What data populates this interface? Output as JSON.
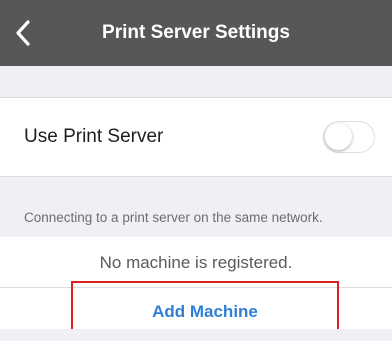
{
  "navbar": {
    "title": "Print Server Settings",
    "back_icon": "chevron-left-icon"
  },
  "settings": {
    "use_print_server": {
      "label": "Use Print Server",
      "enabled": false
    },
    "footnote": "Connecting to a print server on the same network."
  },
  "machines": {
    "empty_message": "No machine is registered.",
    "add_label": "Add Machine"
  },
  "colors": {
    "navbar_bg": "#575757",
    "page_bg": "#efeff4",
    "link_blue": "#2f7fd6",
    "highlight_red": "#e02020"
  }
}
